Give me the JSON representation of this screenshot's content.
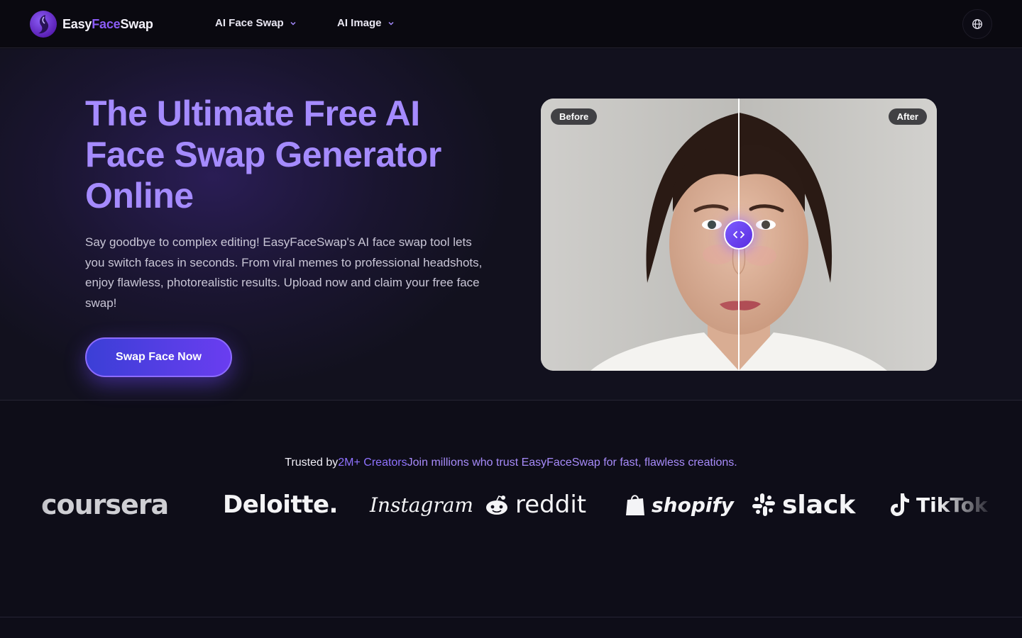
{
  "brand": {
    "name_prefix": "Easy",
    "name_accent": "Face",
    "name_suffix": "Swap"
  },
  "nav": {
    "items": [
      {
        "label": "AI Face Swap"
      },
      {
        "label": "AI Image"
      }
    ],
    "language_icon": "globe-icon"
  },
  "hero": {
    "title": "The Ultimate Free AI Face Swap Generator Online",
    "description": "Say goodbye to complex editing! EasyFaceSwap's AI face swap tool lets you switch faces in seconds. From viral memes to professional headshots, enjoy flawless, photorealistic results. Upload now and claim your free face swap!",
    "cta_label": "Swap Face Now",
    "compare": {
      "before_label": "Before",
      "after_label": "After",
      "handle_icon": "code-arrows-icon"
    }
  },
  "trusted": {
    "prefix": "Trusted by",
    "highlight": "2M+ Creators",
    "suffix": "Join millions who trust EasyFaceSwap for fast, flawless creations.",
    "logos": [
      "coursera",
      "Deloitte.",
      "Instagram",
      "reddit",
      "shopify",
      "slack",
      "TikTok"
    ]
  },
  "colors": {
    "accent": "#a58bff",
    "background": "#0e0d18",
    "cta_start": "#3b3fd6",
    "cta_end": "#6a3df0"
  }
}
